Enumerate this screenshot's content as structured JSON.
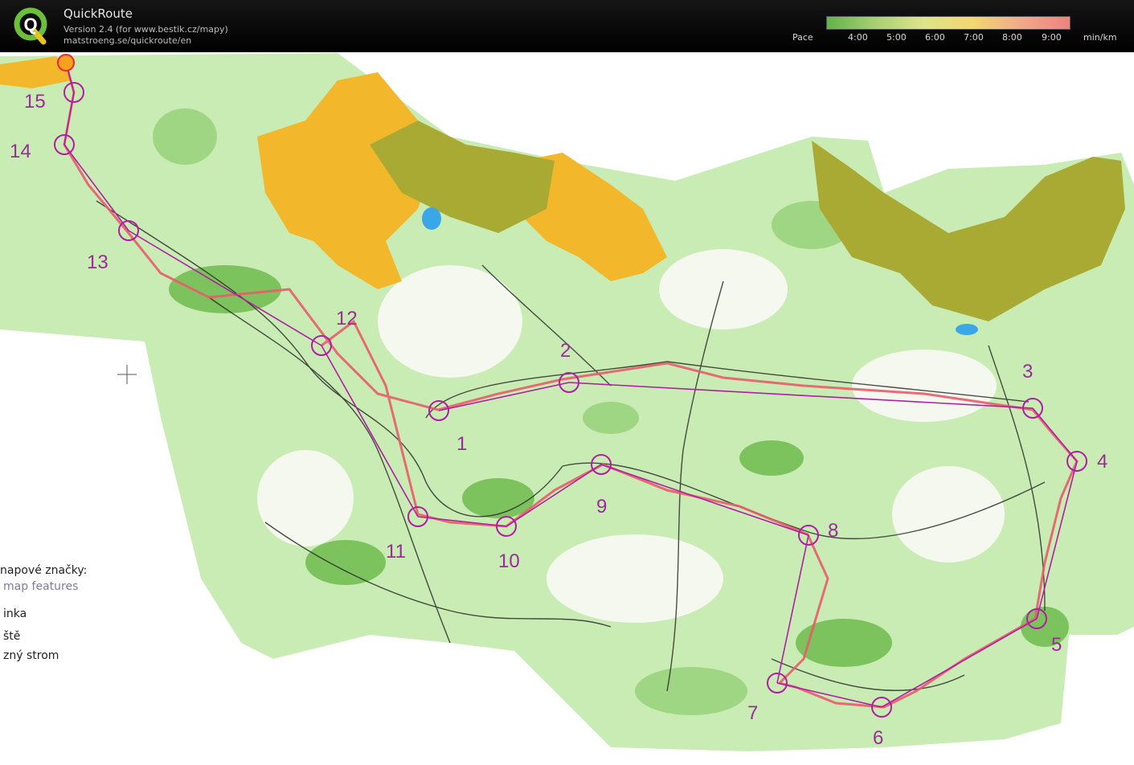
{
  "app": {
    "title": "QuickRoute",
    "version": "Version 2.4  (for www.bestik.cz/mapy)",
    "url": "matstroeng.se/quickroute/en"
  },
  "pace_scale": {
    "label": "Pace",
    "ticks": [
      "4:00",
      "5:00",
      "6:00",
      "7:00",
      "8:00",
      "9:00"
    ],
    "unit": "min/km"
  },
  "map": {
    "controls": [
      "1",
      "2",
      "3",
      "4",
      "5",
      "6",
      "7",
      "8",
      "9",
      "10",
      "11",
      "12",
      "13",
      "14",
      "15"
    ],
    "legend_lines": [
      "napové značky:",
      "map features",
      "inka",
      "ště",
      "zný strom"
    ],
    "colors": {
      "forest": "#bfe5a8",
      "dense_forest": "#7cc35e",
      "open_land": "#f2b72a",
      "settlement": "#a9aa33",
      "course": "#b01ea3",
      "route": "#e85c6a"
    }
  }
}
